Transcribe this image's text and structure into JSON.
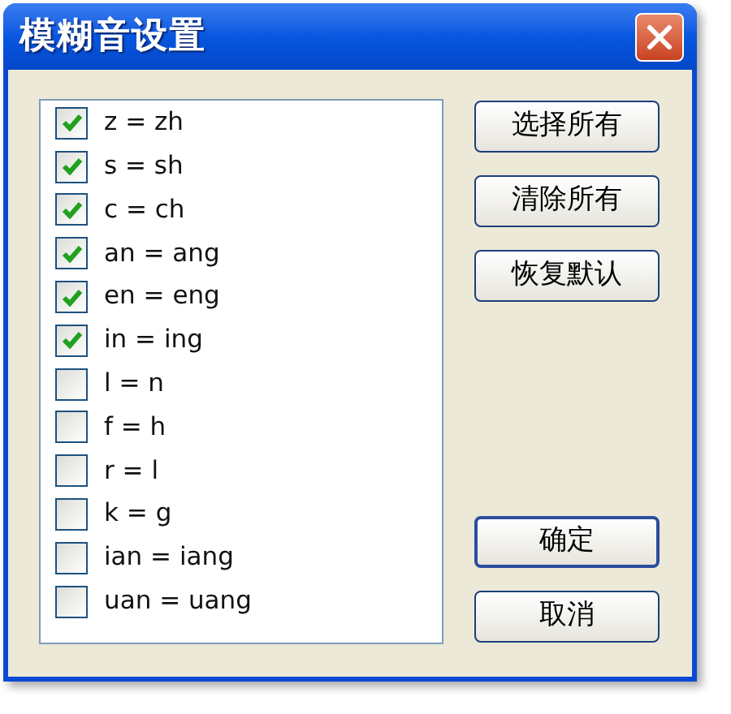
{
  "window": {
    "title": "模糊音设置"
  },
  "options": [
    {
      "label": "z = zh",
      "checked": true
    },
    {
      "label": "s = sh",
      "checked": true
    },
    {
      "label": "c = ch",
      "checked": true
    },
    {
      "label": "an = ang",
      "checked": true
    },
    {
      "label": "en = eng",
      "checked": true
    },
    {
      "label": "in = ing",
      "checked": true
    },
    {
      "label": "l = n",
      "checked": false
    },
    {
      "label": "f = h",
      "checked": false
    },
    {
      "label": "r = l",
      "checked": false
    },
    {
      "label": "k = g",
      "checked": false
    },
    {
      "label": "ian = iang",
      "checked": false
    },
    {
      "label": "uan = uang",
      "checked": false
    }
  ],
  "top_buttons": [
    {
      "label": "选择所有"
    },
    {
      "label": "清除所有"
    },
    {
      "label": "恢复默认"
    }
  ],
  "bottom_buttons": [
    {
      "label": "确定",
      "default": true
    },
    {
      "label": "取消",
      "default": false
    }
  ]
}
